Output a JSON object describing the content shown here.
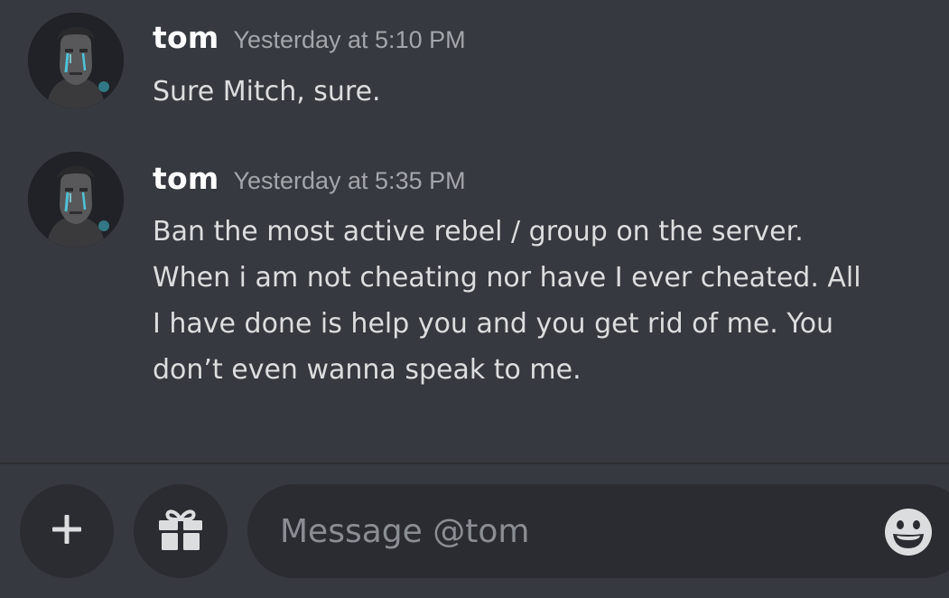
{
  "messages": [
    {
      "author": "tom",
      "timestamp": "Yesterday at 5:10 PM",
      "lines": [
        "Sure Mitch, sure."
      ]
    },
    {
      "author": "tom",
      "timestamp": "Yesterday at 5:35 PM",
      "lines": [
        "Ban the most active rebel / group on the server.",
        "When i am not cheating nor have I ever cheated. All",
        "I have done is help you and you get rid of me. You",
        "don’t even wanna speak to me."
      ]
    }
  ],
  "composer": {
    "placeholder": "Message @tom",
    "value": "",
    "add_icon": "plus-icon",
    "gift_icon": "gift-icon",
    "emoji_icon": "smiley-emoji-icon"
  },
  "colors": {
    "background": "#36393f",
    "input_background": "#2a2c31",
    "username": "#ffffff",
    "timestamp": "#a3a6aa",
    "message_text": "#dcddde",
    "icon": "#dcddde"
  }
}
